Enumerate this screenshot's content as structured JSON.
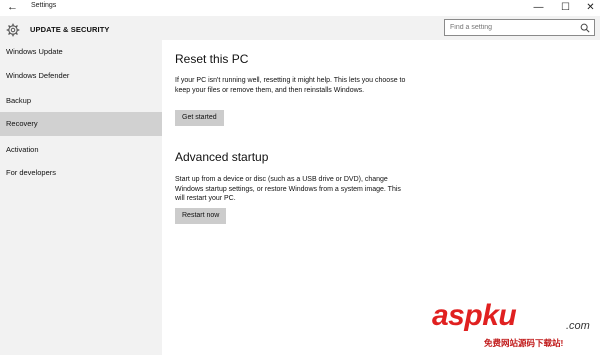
{
  "window": {
    "title": "Settings",
    "back_glyph": "←",
    "minimize_glyph": "—",
    "maximize_glyph": "☐",
    "close_glyph": "✕"
  },
  "sidebar": {
    "header": "UPDATE & SECURITY",
    "items": [
      {
        "label": "Windows Update",
        "selected": false
      },
      {
        "label": "Windows Defender",
        "selected": false
      },
      {
        "label": "Backup",
        "selected": false
      },
      {
        "label": "Recovery",
        "selected": true
      },
      {
        "label": "Activation",
        "selected": false
      },
      {
        "label": "For developers",
        "selected": false
      }
    ]
  },
  "search": {
    "placeholder": "Find a setting",
    "value": ""
  },
  "main": {
    "sections": [
      {
        "heading": "Reset this PC",
        "description": "If your PC isn't running well, resetting it might help. This lets you choose to keep your files or remove them, and then reinstalls Windows.",
        "button": "Get started"
      },
      {
        "heading": "Advanced startup",
        "description": "Start up from a device or disc (such as a USB drive or DVD), change Windows startup settings, or restore Windows from a system image. This will restart your PC.",
        "button": "Restart now"
      }
    ]
  },
  "watermark": {
    "brand": "aspku",
    "tld": ".com",
    "tagline": "免费网站源码下载站!"
  },
  "colors": {
    "sidebar_bg": "#f2f2f2",
    "selected_bg": "#d1d1d1",
    "button_bg": "#cccccc",
    "watermark_red": "#e02020"
  },
  "icons": {
    "back": "back-arrow-icon",
    "header": "gear-icon",
    "search": "search-icon"
  }
}
